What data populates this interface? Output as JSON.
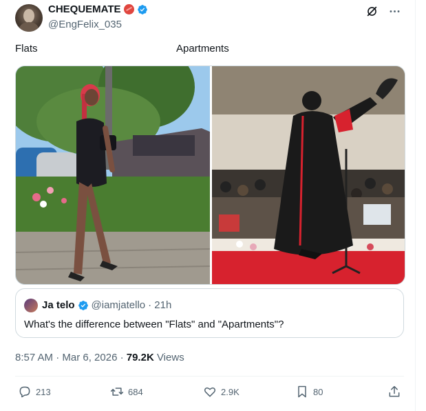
{
  "author": {
    "name": "CHEQUEMATE",
    "handle": "@EngFelix_035"
  },
  "post": {
    "caption_left": "Flats",
    "caption_right": "Apartments"
  },
  "quoted": {
    "name": "Ja telo",
    "handle": "@iamjatello",
    "age": "· 21h",
    "text": "What's the difference between \"Flats\" and \"Apartments\"?"
  },
  "meta": {
    "time": "8:57 AM · Mar 6, 2026 ·",
    "views_count": "79.2K",
    "views_label": "Views"
  },
  "actions": {
    "replies": "213",
    "reposts": "684",
    "likes": "2.9K",
    "bookmarks": "80"
  },
  "icons": [
    "grok-icon",
    "more-icon",
    "verified-badge-icon",
    "reply-icon",
    "repost-icon",
    "like-icon",
    "bookmark-icon",
    "share-icon"
  ],
  "colors": {
    "accent": "#1d9bf0",
    "muted": "#536471",
    "text": "#0f1419"
  }
}
